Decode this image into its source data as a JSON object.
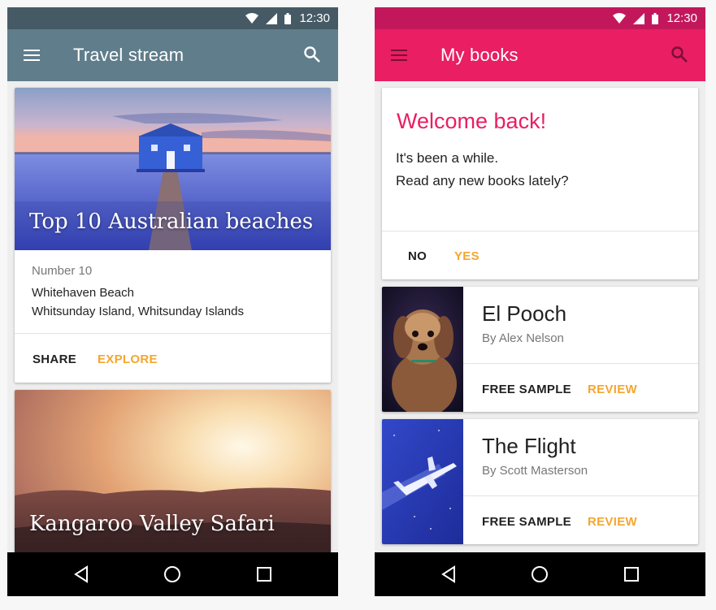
{
  "status": {
    "time": "12:30"
  },
  "left": {
    "title": "Travel stream",
    "colors": {
      "appbar": "#607d8b",
      "statusbar": "#455a64",
      "accent": "#f5a62e"
    },
    "cards": [
      {
        "title": "Top 10 Australian beaches",
        "meta": "Number 10",
        "line1": "Whitehaven Beach",
        "line2": "Whitsunday Island, Whitsunday Islands",
        "actions": [
          "SHARE",
          "EXPLORE"
        ]
      },
      {
        "title": "Kangaroo Valley Safari"
      }
    ]
  },
  "right": {
    "title": "My books",
    "colors": {
      "appbar": "#e91e63",
      "statusbar": "#c2185b",
      "accent": "#f5a62e"
    },
    "welcome": {
      "title": "Welcome back!",
      "line1": "It's been a while.",
      "line2": "Read any new books lately?",
      "actions": [
        "NO",
        "YES"
      ]
    },
    "books": [
      {
        "title": "El Pooch",
        "author": "By Alex Nelson",
        "actions": [
          "FREE SAMPLE",
          "REVIEW"
        ]
      },
      {
        "title": "The Flight",
        "author": "By Scott Masterson",
        "actions": [
          "FREE SAMPLE",
          "REVIEW"
        ]
      }
    ]
  },
  "icons": {
    "menu": "hamburger-menu-icon",
    "search": "search-icon",
    "wifi": "wifi-icon",
    "signal": "cell-signal-icon",
    "battery": "battery-icon",
    "back": "back-triangle-icon",
    "home": "home-circle-icon",
    "recents": "recents-square-icon"
  }
}
